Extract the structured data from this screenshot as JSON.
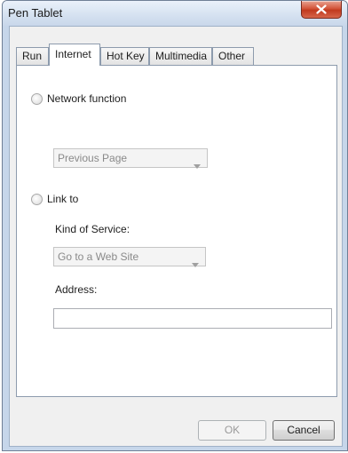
{
  "window": {
    "title": "Pen Tablet",
    "close_icon": "close-icon"
  },
  "tabs": [
    {
      "label": "Run",
      "selected": false
    },
    {
      "label": "Internet",
      "selected": true
    },
    {
      "label": "Hot Key",
      "selected": false
    },
    {
      "label": "Multimedia",
      "selected": false
    },
    {
      "label": "Other",
      "selected": false
    }
  ],
  "internet": {
    "network_function": {
      "label": "Network function",
      "selected": false,
      "dropdown_value": "Previous Page",
      "enabled": false
    },
    "link_to": {
      "label": "Link to",
      "selected": false,
      "kind_of_service_label": "Kind of Service:",
      "kind_of_service_value": "Go to a Web Site",
      "address_label": "Address:",
      "address_value": ""
    }
  },
  "buttons": {
    "ok_label": "OK",
    "ok_enabled": false,
    "cancel_label": "Cancel"
  }
}
